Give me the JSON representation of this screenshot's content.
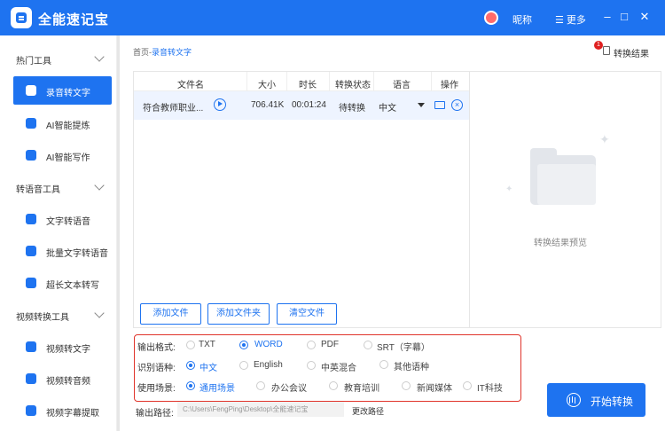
{
  "app": {
    "title": "全能速记宝",
    "nickname": "昵称",
    "menu_label": "☰ 更多"
  },
  "window_controls": [
    "–",
    "□",
    "✕"
  ],
  "sidebar": {
    "sections": [
      {
        "title": "热门工具",
        "items": [
          {
            "label": "录音转文字",
            "active": true
          },
          {
            "label": "AI智能提炼"
          },
          {
            "label": "AI智能写作"
          }
        ]
      },
      {
        "title": "转语音工具",
        "items": [
          {
            "label": "文字转语音"
          },
          {
            "label": "批量文字转语音"
          },
          {
            "label": "超长文本转写"
          }
        ]
      },
      {
        "title": "视频转换工具",
        "items": [
          {
            "label": "视频转文字"
          },
          {
            "label": "视频转音频"
          },
          {
            "label": "视频字幕提取"
          }
        ]
      }
    ]
  },
  "breadcrumb": {
    "home": "首页-",
    "current": "录音转文字"
  },
  "results": {
    "badge": "1",
    "label": "转换结果"
  },
  "table": {
    "headers": [
      "文件名",
      "大小",
      "时长",
      "转换状态",
      "语言",
      "操作"
    ],
    "rows": [
      {
        "name": "符合教师职业...",
        "size": "706.41K",
        "duration": "00:01:24",
        "status": "待转换",
        "language": "中文"
      }
    ]
  },
  "buttons": {
    "add_file": "添加文件",
    "add_folder": "添加文件夹",
    "clear": "清空文件",
    "start": "开始转换"
  },
  "preview": {
    "label": "转换结果预览"
  },
  "options": {
    "format": {
      "label": "输出格式:",
      "choices": [
        "TXT",
        "WORD",
        "PDF",
        "SRT（字幕）"
      ],
      "selected": "WORD"
    },
    "language": {
      "label": "识别语种:",
      "choices": [
        "中文",
        "English",
        "中英混合",
        "其他语种"
      ],
      "selected": "中文"
    },
    "scene": {
      "label": "使用场景:",
      "choices": [
        "通用场景",
        "办公会议",
        "教育培训",
        "新闻媒体",
        "IT科技"
      ],
      "selected": "通用场景"
    }
  },
  "output_path": {
    "label": "输出路径:",
    "value": "C:\\Users\\FengPing\\Desktop\\全能速记宝",
    "change": "更改路径"
  },
  "colors": {
    "accent": "#1e73f0",
    "highlight_border": "#e0342b"
  }
}
